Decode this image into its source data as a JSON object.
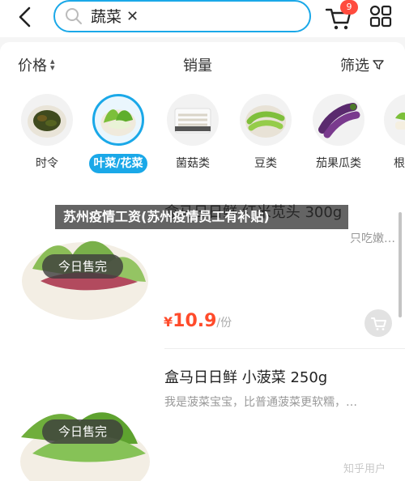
{
  "search": {
    "query": "蔬菜",
    "clear_icon": "close-icon"
  },
  "cart": {
    "badge": "9",
    "icon": "cart-icon"
  },
  "sortbar": {
    "price_label": "价格",
    "sales_label": "销量",
    "filter_label": "筛选"
  },
  "categories": [
    {
      "label": "时令",
      "icon": "herb-dish-icon"
    },
    {
      "label": "叶菜/花菜",
      "icon": "bok-choy-icon",
      "active": true
    },
    {
      "label": "菌菇类",
      "icon": "mushroom-icon"
    },
    {
      "label": "豆类",
      "icon": "edamame-icon"
    },
    {
      "label": "茄果瓜类",
      "icon": "eggplant-icon"
    },
    {
      "label": "根",
      "icon": "root-veg-icon"
    }
  ],
  "products": [
    {
      "title": "盒马日日鲜 红米苋头 300g",
      "desc": "只吃嫩…",
      "price_symbol": "¥",
      "price": "10.9",
      "unit": "/份",
      "tag": "今日售完"
    },
    {
      "title": "盒马日日鲜 小菠菜 250g",
      "desc": "我是菠菜宝宝，比普通菠菜更软糯，…",
      "price_symbol": "",
      "price": "",
      "unit": "",
      "tag": "今日售完"
    }
  ],
  "overlay": {
    "banner": "苏州疫情工资(苏州疫情员工有补贴)",
    "watermark": "知乎用户"
  },
  "colors": {
    "accent": "#1aa8e8",
    "price": "#ff4b2b",
    "badge": "#ff4b3e"
  }
}
